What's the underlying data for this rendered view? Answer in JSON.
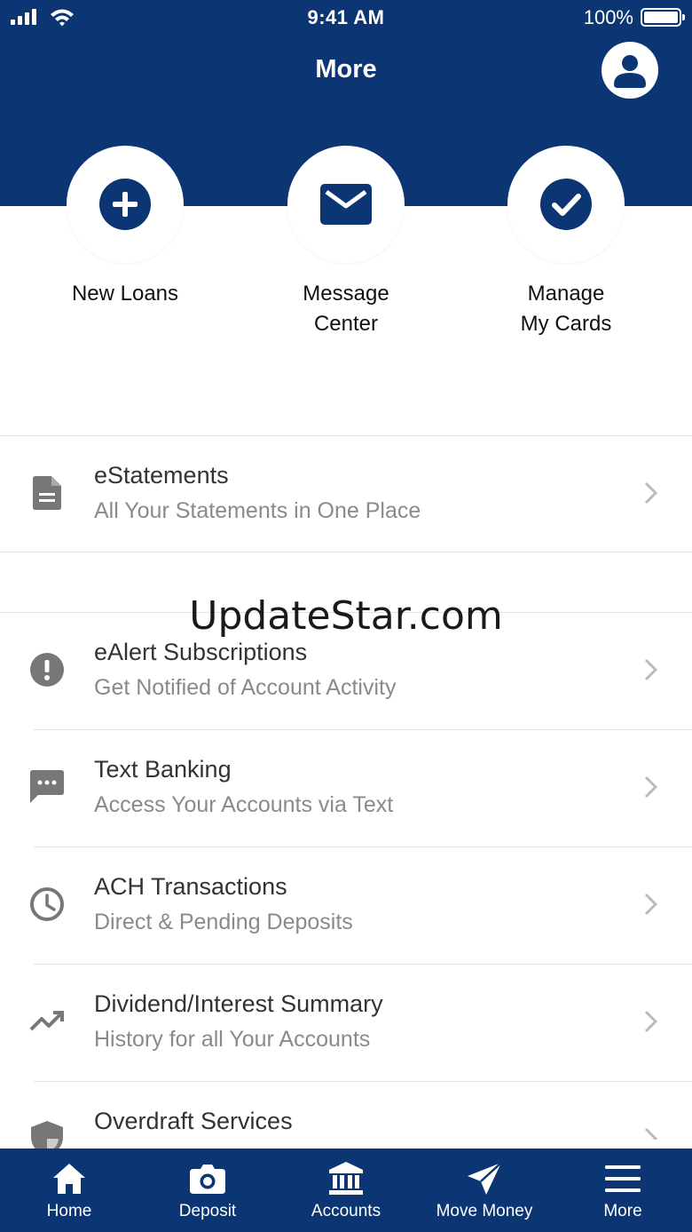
{
  "status_bar": {
    "time": "9:41 AM",
    "battery": "100%"
  },
  "header": {
    "title": "More"
  },
  "quick_actions": [
    {
      "label": "New Loans",
      "icon": "plus-circle-icon"
    },
    {
      "label": "Message\nCenter",
      "icon": "envelope-icon"
    },
    {
      "label": "Manage\nMy Cards",
      "icon": "check-circle-icon"
    }
  ],
  "menu": [
    {
      "title": "eStatements",
      "subtitle": "All Your Statements in One Place",
      "icon": "document-icon"
    },
    {
      "title": "eAlert Subscriptions",
      "subtitle": "Get Notified of Account Activity",
      "icon": "alert-icon"
    },
    {
      "title": "Text Banking",
      "subtitle": "Access Your Accounts via Text",
      "icon": "chat-icon"
    },
    {
      "title": "ACH Transactions",
      "subtitle": "Direct & Pending Deposits",
      "icon": "clock-icon"
    },
    {
      "title": "Dividend/Interest Summary",
      "subtitle": "History for all Your Accounts",
      "icon": "trending-up-icon"
    },
    {
      "title": "Overdraft Services",
      "subtitle": "",
      "icon": "shield-icon"
    }
  ],
  "watermark": "UpdateStar.com",
  "bottom_nav": [
    {
      "label": "Home",
      "icon": "home-icon"
    },
    {
      "label": "Deposit",
      "icon": "camera-icon"
    },
    {
      "label": "Accounts",
      "icon": "bank-icon"
    },
    {
      "label": "Move Money",
      "icon": "send-icon"
    },
    {
      "label": "More",
      "icon": "menu-icon"
    }
  ],
  "colors": {
    "brand": "#0b3673",
    "text_secondary": "#8a8a8a",
    "icon_gray": "#777777"
  }
}
